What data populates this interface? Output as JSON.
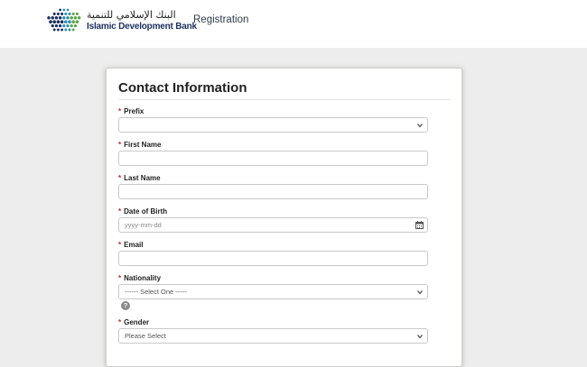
{
  "header": {
    "logo": {
      "arabic_name": "البنك الإسلامي للتنمية",
      "english_name": "Islamic Development Bank"
    },
    "nav_label": "Registration"
  },
  "form": {
    "title": "Contact Information",
    "required_marker": "*",
    "fields": {
      "prefix": {
        "label": "Prefix",
        "value": ""
      },
      "first_name": {
        "label": "First Name",
        "value": ""
      },
      "last_name": {
        "label": "Last Name",
        "value": ""
      },
      "date_of_birth": {
        "label": "Date of Birth",
        "placeholder": "yyyy-mm-dd"
      },
      "email": {
        "label": "Email",
        "value": ""
      },
      "nationality": {
        "label": "Nationality",
        "value": "------ Select One -----"
      },
      "gender": {
        "label": "Gender",
        "value": "Please Select"
      }
    },
    "help_glyph": "?"
  },
  "colors": {
    "page_background": "#ededed",
    "required_marker": "#c8242b",
    "brand_navy": "#1d2f5e",
    "brand_green": "#5aa845"
  },
  "icons": [
    "logo-globe-icon",
    "chevron-down-icon",
    "calendar-icon",
    "help-icon"
  ]
}
